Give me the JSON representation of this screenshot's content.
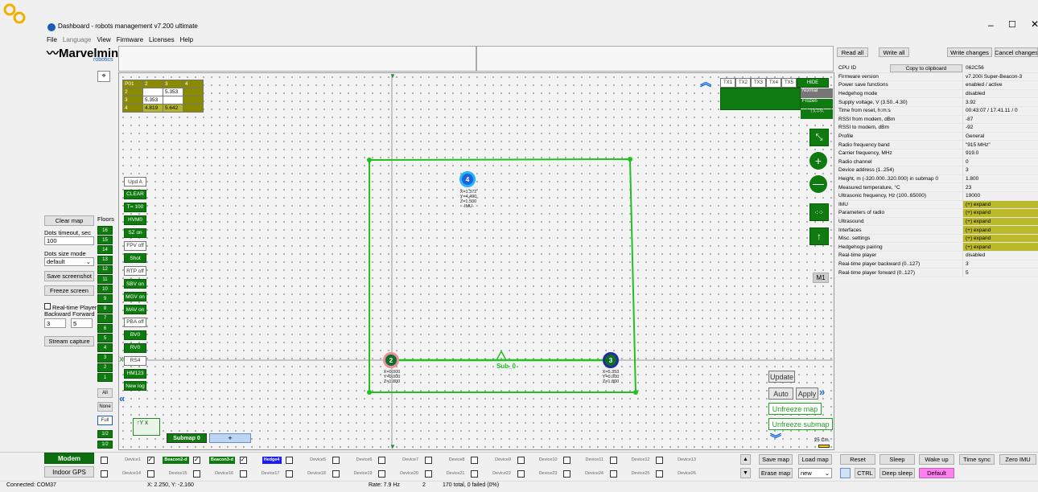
{
  "window": {
    "title": "Dashboard - robots management  v7.200  ultimate",
    "min_icon": "minimize-icon",
    "max_icon": "maximize-icon",
    "close_icon": "close-icon"
  },
  "menu": [
    "File",
    "Language",
    "View",
    "Firmware",
    "Licenses",
    "Help"
  ],
  "logo": {
    "name": "Marvelmind",
    "sub": "robotics"
  },
  "left": {
    "clear_map": "Clear map",
    "dots_timeout_label": "Dots timeout, sec",
    "dots_timeout": "100",
    "dots_size_label": "Dots size mode",
    "dots_size": "default",
    "save_screenshot": "Save screenshot",
    "freeze_screen": "Freeze screen",
    "rt_player": "Real-time Player",
    "backward_forward": "Backward Forward",
    "back_val": "3",
    "fwd_val": "5",
    "stream_capture": "Stream capture"
  },
  "floors": {
    "label": "Floors",
    "items": [
      "16",
      "15",
      "14",
      "13",
      "12",
      "11",
      "10",
      "9",
      "8",
      "7",
      "6",
      "5",
      "4",
      "3",
      "2",
      "1"
    ],
    "all": "All",
    "none": "None",
    "full": "Full",
    "half1": "1/2",
    "half2": "1/2"
  },
  "canvas_buttons": [
    "Upd A",
    "CLEAR",
    "T= 100",
    "HVM0",
    "SZ on",
    "FPV off",
    "Shot",
    "RTP off",
    "SBV on",
    "MGV on",
    "MAV on",
    "PBA off",
    "BV0",
    "RV0",
    "RS4",
    "HM123",
    "New log"
  ],
  "dist_table": {
    "header": [
      "P01",
      "2",
      "3",
      "4"
    ],
    "rows": [
      [
        "2",
        "",
        "5.353",
        ""
      ],
      [
        "3",
        "5.353",
        "",
        ""
      ],
      [
        "4",
        "4.819",
        "5.642",
        ""
      ]
    ]
  },
  "tx": {
    "labels": [
      "TX1",
      "TX2",
      "TX3",
      "TX4",
      "TX5"
    ],
    "hide": "HIDE",
    "normal": "Normal",
    "frozen": "Frozen",
    "tx_pa": "TX-PA"
  },
  "nodes": [
    {
      "id": "4",
      "text": [
        "X=1.372",
        "Y=4.490",
        "Z=1.500",
        "-IMU-"
      ]
    },
    {
      "id": "2",
      "text": [
        "X=0.000",
        "Y=0.000",
        "Z=1.800"
      ]
    },
    {
      "id": "3",
      "text": [
        "X=5.353",
        "Y=0.000",
        "Z=1.800"
      ]
    }
  ],
  "submap_label": "Sub_0",
  "m1": "M1",
  "canvas_right": {
    "update": "Update",
    "auto": "Auto",
    "apply": "Apply",
    "unfreeze_map": "Unfreeze map",
    "unfreeze_submap": "Unfreeze submap",
    "scale": "25 Cm."
  },
  "submap_tab": "Submap 0",
  "submap_add": "+",
  "props_toolbar": {
    "read_all": "Read all",
    "write_all": "Write all",
    "write_changes": "Write changes",
    "cancel_changes": "Cancel changes"
  },
  "props": [
    [
      "CPU ID",
      "062C56"
    ],
    [
      "Firmware version",
      "v7.200i Super-Beacon-3"
    ],
    [
      "Power save functions",
      "enabled / active"
    ],
    [
      "Hedgehog mode",
      "disabled"
    ],
    [
      "Supply voltage, V (3.50..4.30)",
      "3.92"
    ],
    [
      "Time from reset, h:m:s",
      "00:43:07 / 17.41.11 / 0"
    ],
    [
      "RSSI from modem, dBm",
      "-87"
    ],
    [
      "RSSI to modem, dBm",
      "-92"
    ],
    [
      "Profile",
      "General"
    ],
    [
      "Radio frequency band",
      "\"915 MHz\""
    ],
    [
      "Carrier frequency, MHz",
      "919.0"
    ],
    [
      "Radio channel",
      "0"
    ],
    [
      "Device address (1..254)",
      "3"
    ],
    [
      "Height, m (-320.000..320.000) in submap 0",
      "1.800"
    ],
    [
      "Measured temperature, °C",
      "23"
    ],
    [
      "Ultrasonic frequency, Hz (100..65000)",
      "19000"
    ],
    [
      "IMU",
      "(+) expand"
    ],
    [
      "Parameters of radio",
      "(+) expand"
    ],
    [
      "Ultrasound",
      "(+) expand"
    ],
    [
      "Interfaces",
      "(+) expand"
    ],
    [
      "Misc. settings",
      "(+) expand"
    ],
    [
      "Hedgehogs pairing",
      "(+) expand"
    ],
    [
      "Real-time player",
      "disabled"
    ],
    [
      "Real-time player backward (0..127)",
      "3"
    ],
    [
      "Real-time player forward (0..127)",
      "5"
    ]
  ],
  "copy_clipboard": "Copy to clipboard",
  "bottom": {
    "modem": "Modem",
    "indoor_gps": "Indoor GPS",
    "save_map": "Save map",
    "load_map": "Load map",
    "erase_map": "Erase map",
    "new_sel": "new",
    "reset": "Reset",
    "sleep": "Sleep",
    "wake_up": "Wake up",
    "time_sync": "Time sync",
    "zero_imu": "Zero IMU",
    "ctrl": "CTRL",
    "deep_sleep": "Deep sleep",
    "default": "Default"
  },
  "devices_row1": [
    "Device1",
    "Beacon2-d",
    "Beacon3-d",
    "Hedge4",
    "Device5",
    "Device6",
    "Device7",
    "Device8",
    "Device9",
    "Device10",
    "Device11",
    "Device12",
    "Device13"
  ],
  "devices_row2": [
    "Device14",
    "Device15",
    "Device16",
    "Device17",
    "Device18",
    "Device19",
    "Device20",
    "Device21",
    "Device22",
    "Device23",
    "Device24",
    "Device25",
    "Device26"
  ],
  "status": {
    "connected": "Connected: COM37",
    "xy": "X: 2.250, Y: -2.160",
    "rate": "Rate: 7.9 Hz",
    "num": "2",
    "total": "170 total, 0 failed (0%)"
  }
}
